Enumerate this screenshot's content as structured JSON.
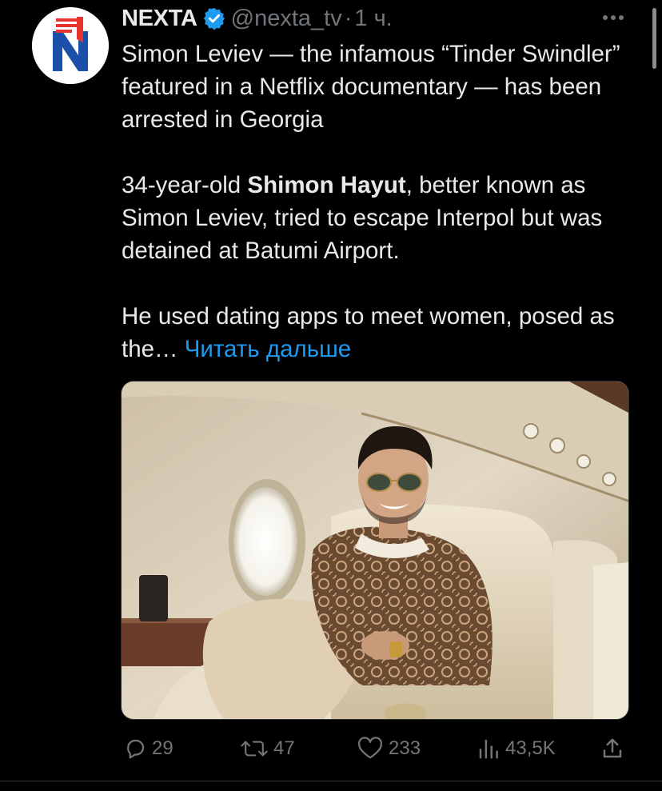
{
  "tweet": {
    "author_name": "NEXTA",
    "handle": "@nexta_tv",
    "separator": "·",
    "time": "1 ч.",
    "body_p1": "Simon Leviev — the infamous “Tinder Swindler” featured in a Netflix documentary — has been arrested in Georgia",
    "body_p2_prefix": "34-year-old ",
    "body_p2_bold": "Shimon Hayut",
    "body_p2_suffix": ", better known as Simon Leviev, tried to escape Interpol but was detained at Batumi Airport.",
    "body_p3": "He used dating apps to meet women, posed as the…",
    "read_more": "Читать дальше",
    "media_description_icon": "photo-man-in-private-jet"
  },
  "actions": {
    "replies": "29",
    "retweets": "47",
    "likes": "233",
    "views": "43,5K"
  },
  "icons": {
    "verified": "verified-badge-icon",
    "more": "more-dots-icon",
    "reply": "reply-icon",
    "retweet": "retweet-icon",
    "like": "heart-icon",
    "views": "views-chart-icon",
    "share": "share-icon"
  },
  "colors": {
    "background": "#000000",
    "text": "#e7e9ea",
    "secondary": "#71767b",
    "accent": "#1d9bf0",
    "brand_red": "#e8342f",
    "brand_blue": "#1c4fa8"
  }
}
